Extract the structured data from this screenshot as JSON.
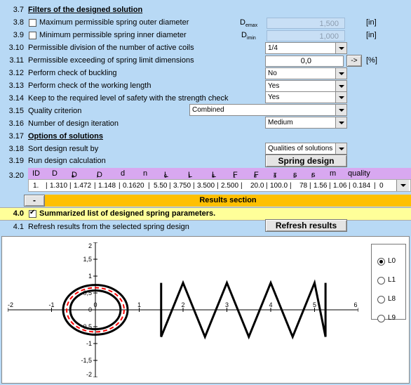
{
  "section37": {
    "num": "3.7",
    "label": "Filters of the designed solution"
  },
  "r38": {
    "num": "3.8",
    "label": "Maximum permissible spring outer diameter",
    "sym": "D",
    "sub": "emax",
    "value": "1,500",
    "unit": "[in]",
    "checked": false
  },
  "r39": {
    "num": "3.9",
    "label": "Minimum permissible spring inner diameter",
    "sym": "D",
    "sub": "imin",
    "value": "1,000",
    "unit": "[in]",
    "checked": false
  },
  "r310": {
    "num": "3.10",
    "label": "Permissible division of the number of active coils",
    "value": "1/4"
  },
  "r311": {
    "num": "3.11",
    "label": "Permissible exceeding of spring limit dimensions",
    "value": "0,0",
    "button": "->",
    "unit": "[%]"
  },
  "r312": {
    "num": "3.12",
    "label": "Perform check of buckling",
    "value": "No"
  },
  "r313": {
    "num": "3.13",
    "label": "Perform check of the working length",
    "value": "Yes"
  },
  "r314": {
    "num": "3.14",
    "label": "Keep to the required level of safety with the strength check",
    "value": "Yes"
  },
  "r315": {
    "num": "3.15",
    "label": "Quality criterion",
    "value": "Combined"
  },
  "r316": {
    "num": "3.16",
    "label": "Number of design iteration",
    "value": "Medium"
  },
  "section317": {
    "num": "3.17",
    "label": "Options of solutions"
  },
  "r318": {
    "num": "3.18",
    "label": "Sort design result by",
    "value": "Qualities of solutions"
  },
  "r319": {
    "num": "3.19",
    "label": "Run design calculation",
    "button": "Spring design"
  },
  "r320": {
    "num": "3.20"
  },
  "table": {
    "headers": [
      "ID",
      "D",
      "D",
      "D",
      "d",
      "n",
      "L",
      "L",
      "L",
      "F",
      "F",
      "τ",
      "s",
      "s",
      "m",
      "quality"
    ],
    "header_subs": [
      "",
      "",
      "e",
      "i",
      "",
      "",
      "0",
      "1",
      "8",
      "1",
      "8",
      "8",
      "s",
      "f",
      "",
      ""
    ],
    "row": [
      "1.",
      "1.310",
      "1.472",
      "1.148",
      "0.1620",
      "5.50",
      "3.750",
      "3.500",
      "2.500",
      "20.0",
      "100.0",
      "78",
      "1.56",
      "1.06",
      "0.184",
      "0"
    ]
  },
  "results": {
    "minus": "-",
    "title": "Results section"
  },
  "r40": {
    "num": "4.0",
    "label": "Summarized list of designed spring parameters.",
    "checked": true
  },
  "r41": {
    "num": "4.1",
    "label": "Refresh results from the selected spring design",
    "button": "Refresh results"
  },
  "chart_data": {
    "type": "line",
    "title": "",
    "xlabel": "",
    "ylabel": "",
    "xlim": [
      -2,
      6
    ],
    "ylim": [
      -2,
      2
    ],
    "xticks": [
      "-2",
      "-1",
      "0",
      "1",
      "2",
      "3",
      "4",
      "5",
      "6"
    ],
    "yticks": [
      "2",
      "1,5",
      "1",
      "0,5",
      "0",
      "-0,5",
      "-1",
      "-1,5",
      "-2"
    ],
    "grid": false,
    "legend_position": "right",
    "legend": [
      {
        "label": "L0",
        "selected": true
      },
      {
        "label": "L1",
        "selected": false
      },
      {
        "label": "L8",
        "selected": false
      },
      {
        "label": "L9",
        "selected": false
      }
    ],
    "series": [
      {
        "kind": "outer-circle",
        "radius": 0.736,
        "color": "#000000"
      },
      {
        "kind": "inner-circle",
        "radius": 0.574,
        "color": "#000000"
      },
      {
        "kind": "mean-circle",
        "radius": 0.655,
        "color": "#ff0000"
      },
      {
        "kind": "coil-zigzag",
        "x": [
          1.5,
          1.5,
          2.0,
          2.5,
          3.0,
          3.5,
          4.0,
          4.5,
          5.0,
          5.25,
          5.25
        ],
        "y": [
          0.8,
          -0.8,
          0.8,
          -0.8,
          0.8,
          -0.8,
          0.8,
          -0.8,
          0.8,
          -0.8,
          0.8
        ],
        "color": "#000000"
      }
    ]
  }
}
